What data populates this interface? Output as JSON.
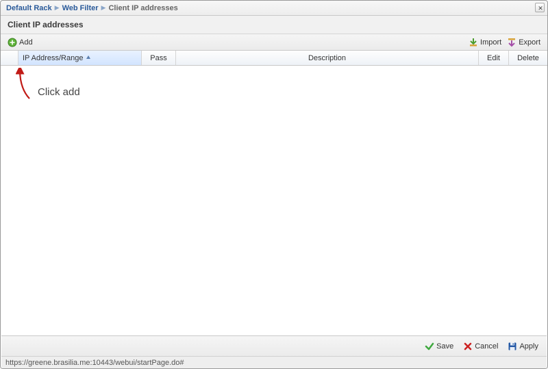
{
  "breadcrumb": {
    "item1": "Default Rack",
    "item2": "Web Filter",
    "item3": "Client IP addresses"
  },
  "title": "Client IP addresses",
  "toolbar": {
    "add_label": "Add",
    "import_label": "Import",
    "export_label": "Export"
  },
  "columns": {
    "ip": "IP Address/Range",
    "pass": "Pass",
    "description": "Description",
    "edit": "Edit",
    "delete": "Delete"
  },
  "rows": [],
  "annotation": {
    "text": "Click add"
  },
  "actions": {
    "save": "Save",
    "cancel": "Cancel",
    "apply": "Apply"
  },
  "status_url": "https://greene.brasilia.me:10443/webui/startPage.do#"
}
